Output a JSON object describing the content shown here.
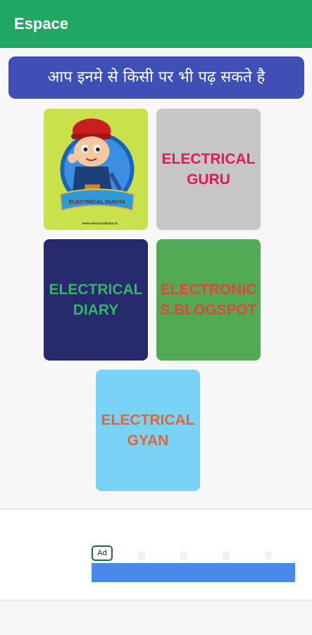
{
  "appbar": {
    "title": "Espace"
  },
  "banner": {
    "text": "आप इनमे से किसी पर भी पढ़ सकते है"
  },
  "tiles": [
    {
      "label": "",
      "image_name": "electrical-duniya-logo"
    },
    {
      "label": "ELECTRICAL GURU"
    },
    {
      "label": "ELECTRICAL DIARY"
    },
    {
      "label": "ELECTRONICS.BLOGSPOT"
    },
    {
      "label": "ELECTRICAL GYAN"
    }
  ],
  "logo": {
    "ribbon_text": "ELECTRICAL DUNIYA",
    "url_text": "www.electricalbaba.in"
  },
  "ad": {
    "badge": "Ad"
  },
  "colors": {
    "appbar": "#21a764",
    "banner": "#3f4fb5",
    "tile1": "#c9e14a",
    "tile2": "#c6c6c6",
    "tile3": "#272a6c",
    "tile4": "#52aa55",
    "tile5": "#79d3f6",
    "ad_bar": "#4a89ea"
  }
}
